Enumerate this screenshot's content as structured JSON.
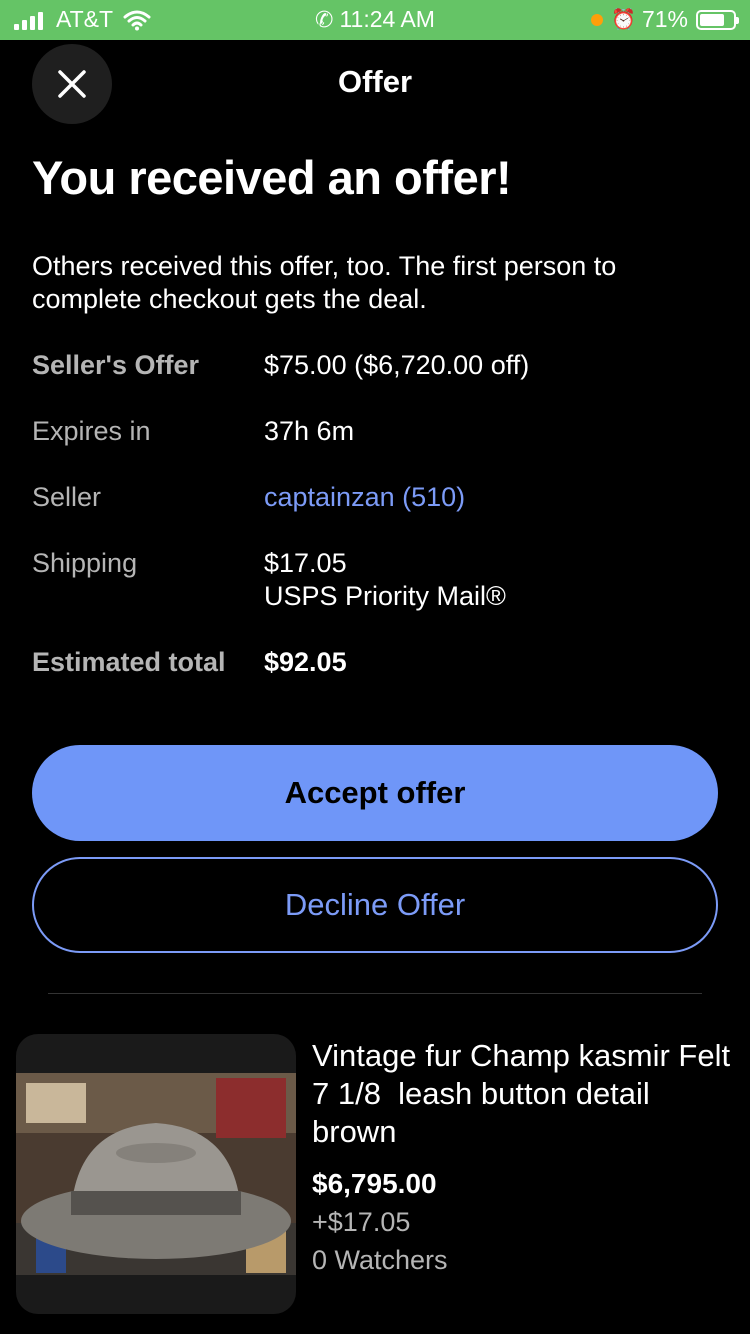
{
  "status_bar": {
    "carrier": "AT&T",
    "time": "11:24 AM",
    "battery": "71%"
  },
  "header": {
    "title": "Offer"
  },
  "headline": "You received an offer!",
  "subtext": "Others received this offer, too. The first person to complete checkout gets the deal.",
  "details": {
    "sellers_offer_label": "Seller's Offer",
    "sellers_offer_value": "$75.00 ($6,720.00 off)",
    "expires_label": "Expires in",
    "expires_value": "37h 6m",
    "seller_label": "Seller",
    "seller_value": "captainzan (510)",
    "shipping_label": "Shipping",
    "shipping_cost": "$17.05",
    "shipping_method": "USPS Priority Mail®",
    "total_label": "Estimated total",
    "total_value": "$92.05"
  },
  "actions": {
    "accept_label": "Accept offer",
    "decline_label": "Decline Offer"
  },
  "item": {
    "title": "Vintage fur Champ kasmir Felt   7 1/8  leash button detail brown",
    "price": "$6,795.00",
    "shipping": "+$17.05",
    "watchers": "0 Watchers"
  },
  "colors": {
    "status_bar": "#65c466",
    "accent": "#6f96f8",
    "link": "#7c9bf7",
    "muted_text": "#b5b5b5"
  }
}
